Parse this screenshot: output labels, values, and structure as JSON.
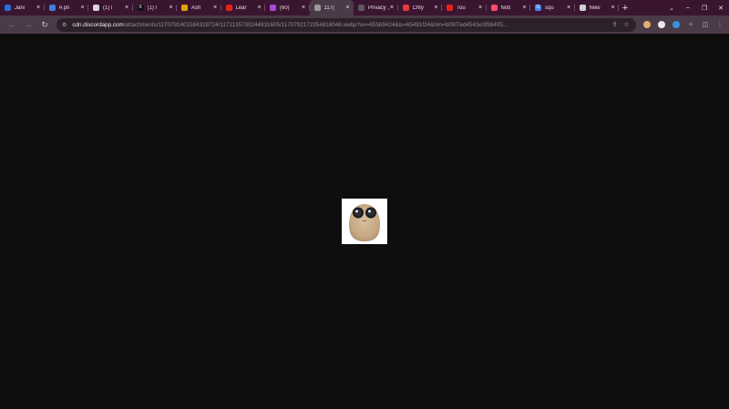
{
  "tabs": [
    {
      "label": "Jani",
      "favicon_color": "#2a6fd6"
    },
    {
      "label": "A pri",
      "favicon_color": "#3d7fe0"
    },
    {
      "label": "(1) l",
      "favicon_color": "#d8d8d8"
    },
    {
      "label": "(1) l",
      "favicon_color": "#111111",
      "favicon_glyph": "X"
    },
    {
      "label": "Ash",
      "favicon_color": "#e2a400"
    },
    {
      "label": "Lear",
      "favicon_color": "#e62117"
    },
    {
      "label": "(60)",
      "favicon_color": "#a84ad8"
    },
    {
      "label": "117(",
      "favicon_color": "#9a9a9a",
      "active": true
    },
    {
      "label": "Privacy ,",
      "favicon_color": "#5a5a5a"
    },
    {
      "label": "Chty",
      "favicon_color": "#e23c3c"
    },
    {
      "label": "Tou",
      "favicon_color": "#e62117"
    },
    {
      "label": "Noti",
      "favicon_color": "#ff4a6a"
    },
    {
      "label": "squ",
      "favicon_color": "#4285f4",
      "favicon_glyph": "G"
    },
    {
      "label": "New",
      "favicon_color": "#cfcfcf"
    }
  ],
  "toolbar": {
    "url_host": "cdn.discordapp.com",
    "url_path": "/attachments/1170791401584328724/1171135730244931605/1170792172354818048.webp?ex=655b9424&is=65491f24&hm=b05f7ed4543e3f98405..."
  },
  "colors": {
    "tabbar_bg": "#3a1530",
    "toolbar_bg": "#4b3a47",
    "page_bg": "#0e0e0e"
  }
}
